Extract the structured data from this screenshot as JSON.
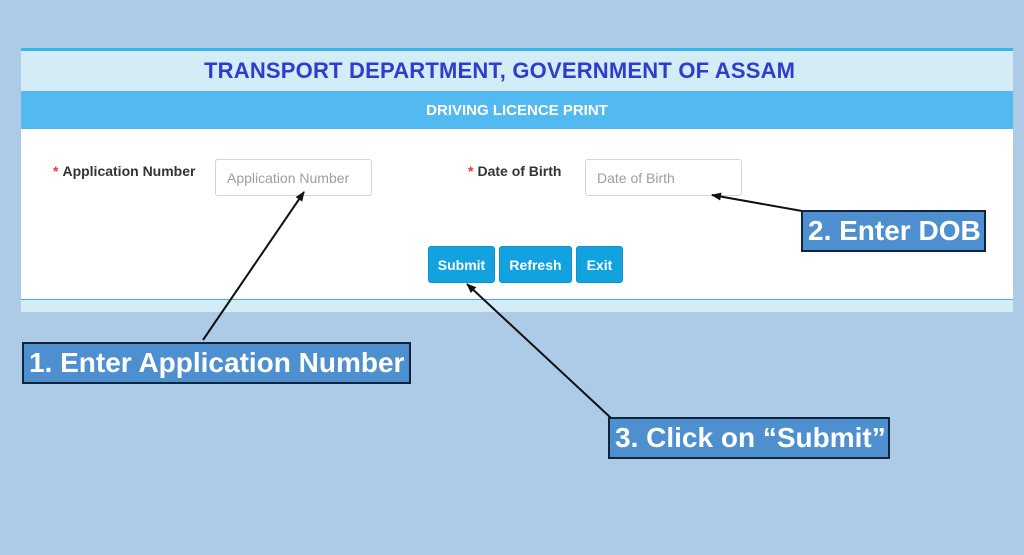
{
  "header": {
    "department_title": "TRANSPORT DEPARTMENT, GOVERNMENT OF ASSAM",
    "form_title": "DRIVING LICENCE PRINT"
  },
  "form": {
    "required_marker": "*",
    "application_number": {
      "label": "Application Number",
      "placeholder": "Application Number",
      "value": ""
    },
    "date_of_birth": {
      "label": "Date of Birth",
      "placeholder": "Date of Birth",
      "value": ""
    }
  },
  "buttons": {
    "submit": "Submit",
    "refresh": "Refresh",
    "exit": "Exit"
  },
  "callouts": {
    "step1": "1. Enter Application Number",
    "step2": "2. Enter DOB",
    "step3": "3. Click on “Submit”"
  },
  "colors": {
    "page_background": "#adcbe7",
    "title_blue": "#2f3ccd",
    "subheader_blue": "#52baf0",
    "button_blue": "#12a2e0",
    "callout_blue": "#4e8fd0",
    "required_red": "#e53935"
  }
}
